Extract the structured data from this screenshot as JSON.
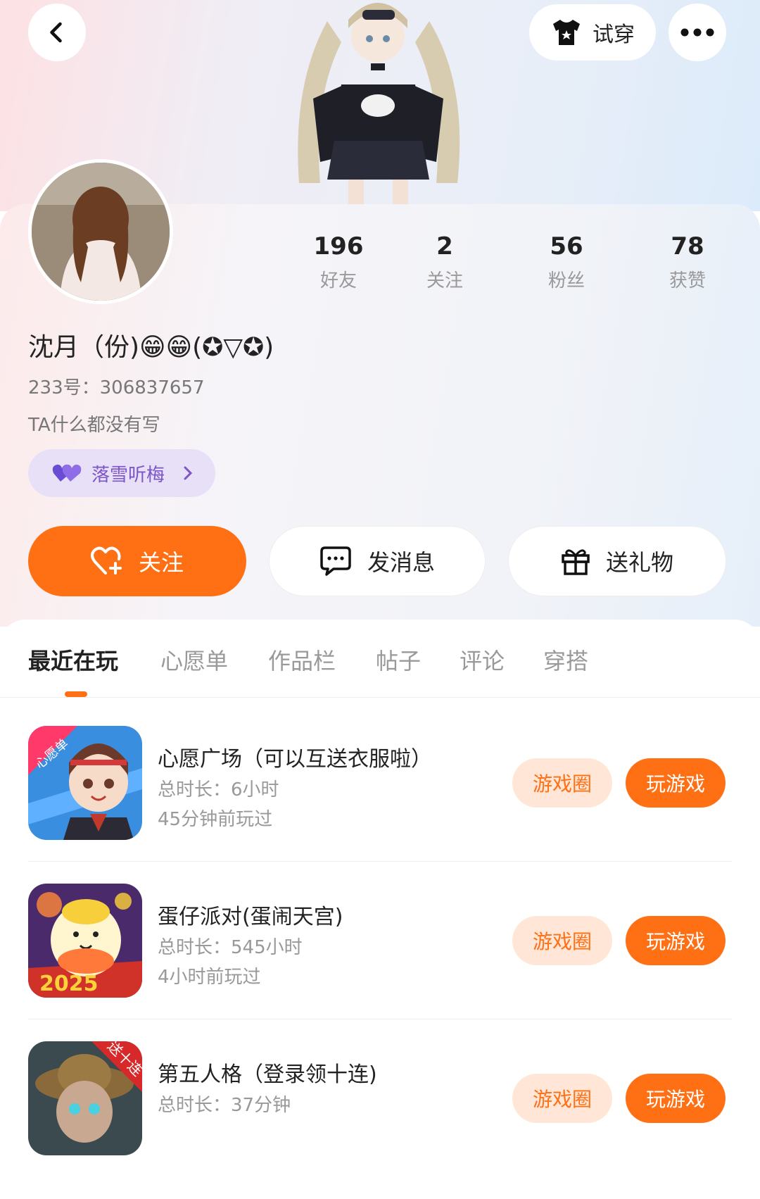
{
  "header": {
    "back_icon": "chevron-left-icon",
    "tryon_label": "试穿",
    "more_icon": "more-dots-icon"
  },
  "stats": [
    {
      "value": "196",
      "label": "好友"
    },
    {
      "value": "2",
      "label": "关注"
    },
    {
      "value": "56",
      "label": "粉丝"
    },
    {
      "value": "78",
      "label": "获赞"
    }
  ],
  "profile": {
    "nickname": "沈月（份)😁😁(✪▽✪)",
    "uid": "233号：306837657",
    "bio": "TA什么都没有写",
    "tag_label": "落雪听梅"
  },
  "actions": {
    "follow": "关注",
    "message": "发消息",
    "gift": "送礼物"
  },
  "tabs": [
    "最近在玩",
    "心愿单",
    "作品栏",
    "帖子",
    "评论",
    "穿搭"
  ],
  "games": [
    {
      "title": "心愿广场（可以互送衣服啦）",
      "total": "总时长：6小时",
      "last": "45分钟前玩过",
      "badge": "心愿单",
      "circle": "游戏圈",
      "play": "玩游戏"
    },
    {
      "title": "蛋仔派对(蛋闹天宫)",
      "total": "总时长：545小时",
      "last": "4小时前玩过",
      "badge": "2025",
      "circle": "游戏圈",
      "play": "玩游戏"
    },
    {
      "title": "第五人格（登录领十连)",
      "total": "总时长：37分钟",
      "last": "",
      "badge": "送十连",
      "circle": "游戏圈",
      "play": "玩游戏"
    }
  ],
  "colors": {
    "accent": "#ff7015",
    "accent_light": "#ffe6d6",
    "tag_bg": "#e8e0f6",
    "tag_fg": "#7c55c9"
  }
}
